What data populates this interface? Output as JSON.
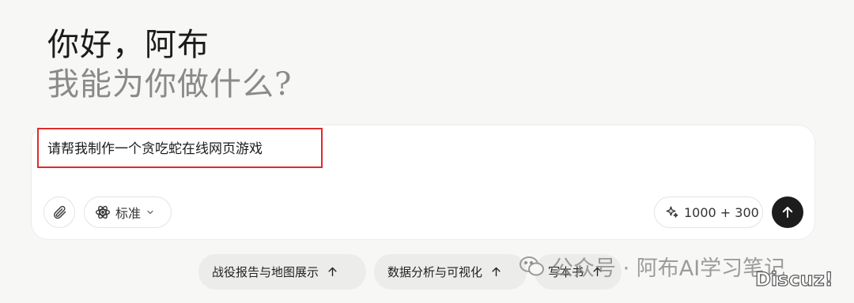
{
  "greeting": {
    "hello": "你好，阿布",
    "subtitle": "我能为你做什么?"
  },
  "composer": {
    "prompt": "请帮我制作一个贪吃蛇在线网页游戏",
    "mode_label": "标准",
    "quota_label": "1000 + 300",
    "icons": {
      "attach": "paperclip-icon",
      "mode": "atom-icon",
      "chevron": "chevron-down-icon",
      "quota": "sparkle-icon",
      "send": "arrow-up-icon"
    },
    "highlight_color": "#e12a2a"
  },
  "suggestions": [
    {
      "label": "战役报告与地图展示"
    },
    {
      "label": "数据分析与可视化"
    },
    {
      "label": "写本书"
    }
  ],
  "watermark": {
    "text": "公众号 · 阿布AI学习笔记",
    "badge": "Discuz!"
  }
}
